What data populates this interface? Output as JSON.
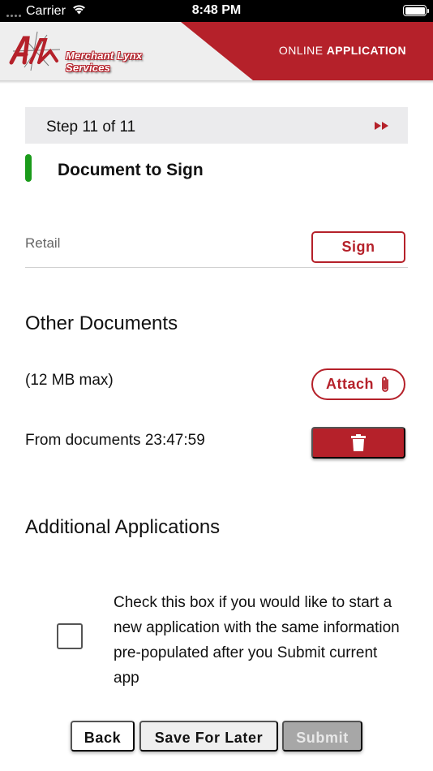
{
  "status_bar": {
    "carrier": "Carrier",
    "time": "8:48 PM",
    "battery_level": 1.0
  },
  "header": {
    "logo_text": "Merchant Lynx Services",
    "title_prefix": "ONLINE",
    "title_suffix": "APPLICATION",
    "brand_color": "#b5212a"
  },
  "step": {
    "label": "Step 11 of 11",
    "next_icon": "fast-forward-icon"
  },
  "document_to_sign": {
    "title": "Document to Sign",
    "accent_color": "#1a9b1a",
    "item_label": "Retail",
    "sign_label": "Sign"
  },
  "other_documents": {
    "title": "Other Documents",
    "size_hint": "(12 MB max)",
    "attach_label": "Attach",
    "attach_icon": "paperclip-icon",
    "file_name": "From documents 23:47:59",
    "delete_icon": "trash-icon"
  },
  "additional_applications": {
    "title": "Additional Applications",
    "checkbox_checked": false,
    "checkbox_text": "Check this box if you would like to start a new application with the same information pre-populated after you Submit current app"
  },
  "footer": {
    "back_label": "Back",
    "save_label": "Save For Later",
    "submit_label": "Submit",
    "submit_enabled": false
  }
}
